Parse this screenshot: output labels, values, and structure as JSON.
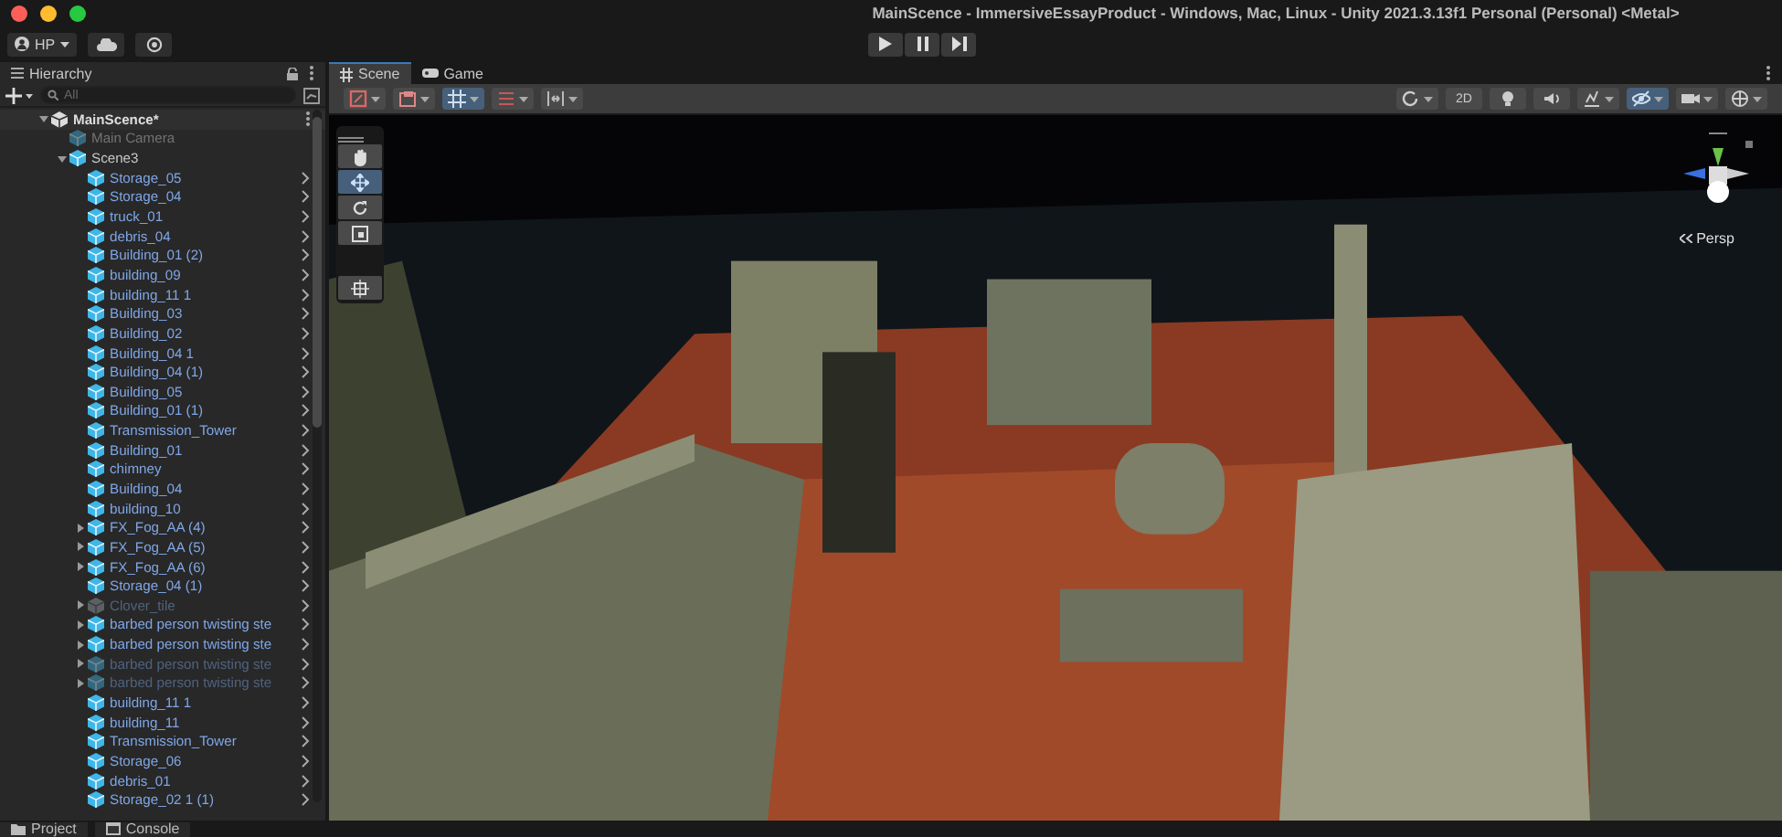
{
  "window": {
    "title": "MainScence - ImmersiveEssayProduct - Windows, Mac, Linux - Unity 2021.3.13f1 Personal (Personal) <Metal>"
  },
  "toolbar": {
    "account": "HP"
  },
  "hierarchy": {
    "tab": "Hierarchy",
    "search": {
      "placeholder": "All"
    },
    "tree": [
      {
        "label": "MainScence*",
        "kind": "scene",
        "active": true,
        "expanded": true,
        "children": [
          {
            "label": "Main Camera",
            "kind": "object",
            "active": false,
            "prefab": false
          },
          {
            "label": "Scene3",
            "kind": "object",
            "active": true,
            "prefab": false,
            "expanded": true,
            "children": [
              {
                "label": "Storage_05",
                "kind": "object",
                "active": true,
                "prefab": true
              },
              {
                "label": "Storage_04",
                "kind": "object",
                "active": true,
                "prefab": true
              },
              {
                "label": "truck_01",
                "kind": "object",
                "active": true,
                "prefab": true
              },
              {
                "label": "debris_04",
                "kind": "object",
                "active": true,
                "prefab": true
              },
              {
                "label": "Building_01 (2)",
                "kind": "object",
                "active": true,
                "prefab": true
              },
              {
                "label": "building_09",
                "kind": "object",
                "active": true,
                "prefab": true
              },
              {
                "label": "building_11 1",
                "kind": "object",
                "active": true,
                "prefab": true
              },
              {
                "label": "Building_03",
                "kind": "object",
                "active": true,
                "prefab": true
              },
              {
                "label": "Building_02",
                "kind": "object",
                "active": true,
                "prefab": true
              },
              {
                "label": "Building_04 1",
                "kind": "object",
                "active": true,
                "prefab": true
              },
              {
                "label": "Building_04 (1)",
                "kind": "object",
                "active": true,
                "prefab": true
              },
              {
                "label": "Building_05",
                "kind": "object",
                "active": true,
                "prefab": true
              },
              {
                "label": "Building_01 (1)",
                "kind": "object",
                "active": true,
                "prefab": true
              },
              {
                "label": "Transmission_Tower",
                "kind": "object",
                "active": true,
                "prefab": true
              },
              {
                "label": "Building_01",
                "kind": "object",
                "active": true,
                "prefab": true
              },
              {
                "label": "chimney",
                "kind": "object",
                "active": true,
                "prefab": true
              },
              {
                "label": "Building_04",
                "kind": "object",
                "active": true,
                "prefab": true
              },
              {
                "label": "building_10",
                "kind": "object",
                "active": true,
                "prefab": true
              },
              {
                "label": "FX_Fog_AA (4)",
                "kind": "object",
                "active": true,
                "prefab": true,
                "expanded": false
              },
              {
                "label": "FX_Fog_AA (5)",
                "kind": "object",
                "active": true,
                "prefab": true,
                "expanded": false
              },
              {
                "label": "FX_Fog_AA (6)",
                "kind": "object",
                "active": true,
                "prefab": true,
                "expanded": false
              },
              {
                "label": "Storage_04 (1)",
                "kind": "object",
                "active": true,
                "prefab": true
              },
              {
                "label": "Clover_tile",
                "kind": "model",
                "active": false,
                "prefab": true,
                "expanded": false
              },
              {
                "label": "barbed person twisting ste",
                "kind": "object",
                "active": true,
                "prefab": true,
                "expanded": false
              },
              {
                "label": "barbed person twisting ste",
                "kind": "object",
                "active": true,
                "prefab": true,
                "expanded": false
              },
              {
                "label": "barbed person twisting ste",
                "kind": "object",
                "active": false,
                "prefab": true,
                "expanded": false
              },
              {
                "label": "barbed person twisting ste",
                "kind": "object",
                "active": false,
                "prefab": true,
                "expanded": false
              },
              {
                "label": "building_11 1",
                "kind": "object",
                "active": true,
                "prefab": true
              },
              {
                "label": "building_11",
                "kind": "object",
                "active": true,
                "prefab": true
              },
              {
                "label": "Transmission_Tower",
                "kind": "object",
                "active": true,
                "prefab": true
              },
              {
                "label": "Storage_06",
                "kind": "object",
                "active": true,
                "prefab": true
              },
              {
                "label": "debris_01",
                "kind": "object",
                "active": true,
                "prefab": true
              },
              {
                "label": "Storage_02 1 (1)",
                "kind": "object",
                "active": true,
                "prefab": true
              }
            ]
          }
        ]
      }
    ]
  },
  "scene_view": {
    "tabs": [
      {
        "label": "Scene",
        "selected": true
      },
      {
        "label": "Game",
        "selected": false
      }
    ],
    "toolbar_left": [
      {
        "kind": "shading",
        "selected": false
      },
      {
        "kind": "render",
        "selected": false
      },
      {
        "kind": "grid",
        "selected": true
      },
      {
        "kind": "increment",
        "selected": false
      },
      {
        "kind": "snap",
        "selected": false
      }
    ],
    "toolbar_right": [
      {
        "kind": "orientation",
        "selected": false
      },
      {
        "kind": "mode",
        "label": "2D",
        "selected": false
      },
      {
        "kind": "lighting",
        "selected": false
      },
      {
        "kind": "audio",
        "selected": false
      },
      {
        "kind": "effects",
        "selected": false
      },
      {
        "kind": "visibility",
        "selected": true
      },
      {
        "kind": "camera",
        "selected": false
      },
      {
        "kind": "gizmos",
        "selected": false
      }
    ],
    "tools": [
      {
        "kind": "hand",
        "selected": false
      },
      {
        "kind": "move",
        "selected": true
      },
      {
        "kind": "rotate",
        "selected": false
      },
      {
        "kind": "scale",
        "selected": false
      },
      {
        "kind": "custom",
        "selected": false
      }
    ],
    "projection": "Persp"
  },
  "bottom_tabs": [
    {
      "label": "Project",
      "kind": "folder"
    },
    {
      "label": "Console",
      "kind": "console"
    }
  ]
}
